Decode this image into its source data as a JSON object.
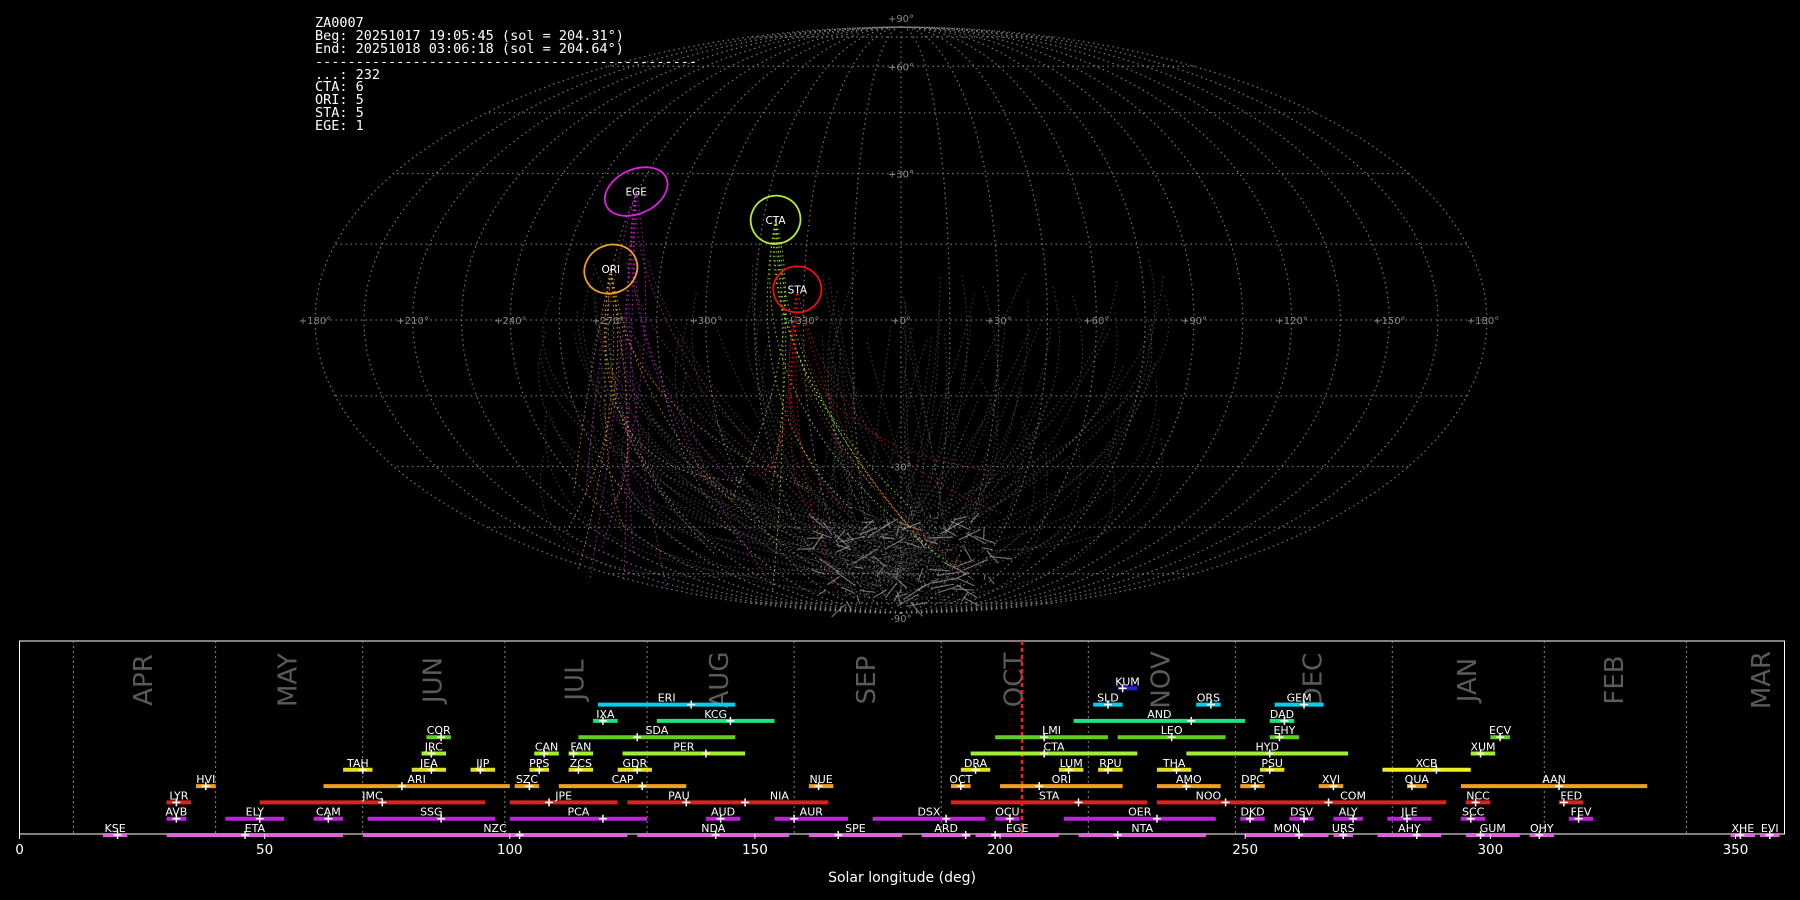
{
  "info": {
    "lines": [
      "ZA0007",
      "Beg: 20251017 19:05:45 (sol = 204.31°)",
      "End: 20251018 03:06:18 (sol = 204.64°)",
      "-----------------------------------------------",
      "...: 232",
      "CTA: 6",
      "ORI: 5",
      "STA: 5",
      "EGE: 1"
    ]
  },
  "sky_map": {
    "lon_labels": [
      "+180°",
      "+150°",
      "+120°",
      "+90°",
      "+60°",
      "+30°",
      "+0°",
      "+330°",
      "+300°",
      "+270°",
      "+240°",
      "+210°",
      "+180°"
    ],
    "lat_labels": [
      "+90°",
      "+60°",
      "+30°",
      "-30°",
      "-90°"
    ],
    "radiants": [
      {
        "code": "EGE",
        "color": "#e020e0",
        "lon": 90.5,
        "lat": 26,
        "rx": 33,
        "ry": 22,
        "rot": -25
      },
      {
        "code": "ORI",
        "color": "#f0a020",
        "lon": 90.5,
        "lat": 10,
        "rx": 27,
        "ry": 24,
        "rot": -25
      },
      {
        "code": "CTA",
        "color": "#b0f030",
        "lon": 41,
        "lat": 20,
        "rx": 25,
        "ry": 24,
        "rot": -20
      },
      {
        "code": "STA",
        "color": "#f01010",
        "lon": 32,
        "lat": 6,
        "rx": 24,
        "ry": 23,
        "rot": 0
      }
    ]
  },
  "chart_data": {
    "type": "timeline",
    "xlabel": "Solar longitude (deg)",
    "xlim": [
      0,
      360
    ],
    "xticks": [
      0,
      50,
      100,
      150,
      200,
      250,
      300,
      350
    ],
    "current_sol": 204.5,
    "months": [
      {
        "label": "APR",
        "sol": 11
      },
      {
        "label": "MAY",
        "sol": 40
      },
      {
        "label": "JUN",
        "sol": 70
      },
      {
        "label": "JUL",
        "sol": 99
      },
      {
        "label": "AUG",
        "sol": 128
      },
      {
        "label": "SEP",
        "sol": 158
      },
      {
        "label": "OCT",
        "sol": 188
      },
      {
        "label": "NOV",
        "sol": 218
      },
      {
        "label": "DEC",
        "sol": 248
      },
      {
        "label": "JAN",
        "sol": 280
      },
      {
        "label": "FEB",
        "sol": 311
      },
      {
        "label": "MAR",
        "sol": 340
      }
    ],
    "showers": [
      {
        "code": "KUM",
        "start": 224,
        "end": 228,
        "peak": 225,
        "row": 9,
        "color": "#2020e0"
      },
      {
        "code": "ERI",
        "start": 118,
        "end": 146,
        "peak": 137,
        "row": 8,
        "color": "#00d0f0"
      },
      {
        "code": "SLD",
        "start": 219,
        "end": 225,
        "peak": 222,
        "row": 8,
        "color": "#00d0f0"
      },
      {
        "code": "ORS",
        "start": 240,
        "end": 245,
        "peak": 243,
        "row": 8,
        "color": "#00d0f0"
      },
      {
        "code": "GEM",
        "start": 256,
        "end": 266,
        "peak": 262,
        "row": 8,
        "color": "#00d0f0"
      },
      {
        "code": "IXA",
        "start": 117,
        "end": 122,
        "peak": 119,
        "row": 7,
        "color": "#20e080"
      },
      {
        "code": "KCG",
        "start": 130,
        "end": 154,
        "peak": 145,
        "row": 7,
        "color": "#20e080"
      },
      {
        "code": "AND",
        "start": 215,
        "end": 250,
        "peak": 239,
        "row": 7,
        "color": "#20e080"
      },
      {
        "code": "DAD",
        "start": 255,
        "end": 260,
        "peak": 258,
        "row": 7,
        "color": "#20e080"
      },
      {
        "code": "COR",
        "start": 83,
        "end": 88,
        "peak": 86,
        "row": 6,
        "color": "#60d020"
      },
      {
        "code": "SDA",
        "start": 114,
        "end": 146,
        "peak": 126,
        "row": 6,
        "color": "#60d020"
      },
      {
        "code": "LMI",
        "start": 199,
        "end": 222,
        "peak": 209,
        "row": 6,
        "color": "#60d020"
      },
      {
        "code": "LEO",
        "start": 224,
        "end": 246,
        "peak": 235,
        "row": 6,
        "color": "#60d020"
      },
      {
        "code": "EHY",
        "start": 255,
        "end": 261,
        "peak": 257,
        "row": 6,
        "color": "#60d020"
      },
      {
        "code": "ECV",
        "start": 300,
        "end": 304,
        "peak": 302,
        "row": 6,
        "color": "#60d020"
      },
      {
        "code": "JRC",
        "start": 82,
        "end": 87,
        "peak": 84,
        "row": 5,
        "color": "#a0f030"
      },
      {
        "code": "CAN",
        "start": 105,
        "end": 110,
        "peak": 107,
        "row": 5,
        "color": "#a0f030"
      },
      {
        "code": "FAN",
        "start": 112,
        "end": 117,
        "peak": 113,
        "row": 5,
        "color": "#a0f030"
      },
      {
        "code": "PER",
        "start": 123,
        "end": 148,
        "peak": 140,
        "row": 5,
        "color": "#a0f030"
      },
      {
        "code": "CTA",
        "start": 194,
        "end": 228,
        "peak": 209,
        "row": 5,
        "color": "#a0f030"
      },
      {
        "code": "HYD",
        "start": 238,
        "end": 271,
        "peak": 255,
        "row": 5,
        "color": "#a0f030"
      },
      {
        "code": "XUM",
        "start": 296,
        "end": 301,
        "peak": 298,
        "row": 5,
        "color": "#a0f030"
      },
      {
        "code": "TAH",
        "start": 66,
        "end": 72,
        "peak": 70,
        "row": 4,
        "color": "#e0e020"
      },
      {
        "code": "JEA",
        "start": 80,
        "end": 87,
        "peak": 84,
        "row": 4,
        "color": "#e0e020"
      },
      {
        "code": "JIP",
        "start": 92,
        "end": 97,
        "peak": 94,
        "row": 4,
        "color": "#e0e020"
      },
      {
        "code": "PPS",
        "start": 104,
        "end": 108,
        "peak": 106,
        "row": 4,
        "color": "#e0e020"
      },
      {
        "code": "ZCS",
        "start": 112,
        "end": 117,
        "peak": 114,
        "row": 4,
        "color": "#e0e020"
      },
      {
        "code": "GDR",
        "start": 122,
        "end": 129,
        "peak": 126,
        "row": 4,
        "color": "#e0e020"
      },
      {
        "code": "DRA",
        "start": 192,
        "end": 198,
        "peak": 195,
        "row": 4,
        "color": "#e0e020"
      },
      {
        "code": "LUM",
        "start": 212,
        "end": 217,
        "peak": 214,
        "row": 4,
        "color": "#e0e020"
      },
      {
        "code": "RPU",
        "start": 220,
        "end": 225,
        "peak": 222,
        "row": 4,
        "color": "#e0e020"
      },
      {
        "code": "THA",
        "start": 232,
        "end": 239,
        "peak": 236,
        "row": 4,
        "color": "#e0e020"
      },
      {
        "code": "PSU",
        "start": 253,
        "end": 258,
        "peak": 255,
        "row": 4,
        "color": "#e0e020"
      },
      {
        "code": "XCB",
        "start": 278,
        "end": 296,
        "peak": 289,
        "row": 4,
        "color": "#f0f020"
      },
      {
        "code": "HVI",
        "start": 36,
        "end": 40,
        "peak": 38,
        "row": 3,
        "color": "#f0a020"
      },
      {
        "code": "ARI",
        "start": 62,
        "end": 100,
        "peak": 78,
        "row": 3,
        "color": "#f0a020"
      },
      {
        "code": "SZC",
        "start": 101,
        "end": 106,
        "peak": 104,
        "row": 3,
        "color": "#f0a020"
      },
      {
        "code": "CAP",
        "start": 110,
        "end": 136,
        "peak": 127,
        "row": 3,
        "color": "#f0a020"
      },
      {
        "code": "NUE",
        "start": 161,
        "end": 166,
        "peak": 163,
        "row": 3,
        "color": "#f0a020"
      },
      {
        "code": "OCT",
        "start": 190,
        "end": 194,
        "peak": 192,
        "row": 3,
        "color": "#f0a020"
      },
      {
        "code": "ORI",
        "start": 200,
        "end": 225,
        "peak": 208,
        "row": 3,
        "color": "#f0a020"
      },
      {
        "code": "AMO",
        "start": 232,
        "end": 245,
        "peak": 238,
        "row": 3,
        "color": "#f0a020"
      },
      {
        "code": "DPC",
        "start": 249,
        "end": 254,
        "peak": 252,
        "row": 3,
        "color": "#f0a020"
      },
      {
        "code": "XVI",
        "start": 265,
        "end": 270,
        "peak": 268,
        "row": 3,
        "color": "#f0a020"
      },
      {
        "code": "QUA",
        "start": 283,
        "end": 287,
        "peak": 284,
        "row": 3,
        "color": "#f0a020"
      },
      {
        "code": "AAN",
        "start": 294,
        "end": 332,
        "peak": 314,
        "row": 3,
        "color": "#f0a020"
      },
      {
        "code": "LYR",
        "start": 30,
        "end": 35,
        "peak": 32,
        "row": 2,
        "color": "#e02020"
      },
      {
        "code": "JMC",
        "start": 49,
        "end": 95,
        "peak": 74,
        "row": 2,
        "color": "#e02020"
      },
      {
        "code": "JPE",
        "start": 100,
        "end": 122,
        "peak": 108,
        "row": 2,
        "color": "#e02020"
      },
      {
        "code": "PAU",
        "start": 124,
        "end": 145,
        "peak": 136,
        "row": 2,
        "color": "#e02020"
      },
      {
        "code": "NIA",
        "start": 145,
        "end": 165,
        "peak": 148,
        "row": 2,
        "color": "#e02020"
      },
      {
        "code": "STA",
        "start": 190,
        "end": 230,
        "peak": 216,
        "row": 2,
        "color": "#e02020"
      },
      {
        "code": "NOO",
        "start": 232,
        "end": 253,
        "peak": 246,
        "row": 2,
        "color": "#e02020"
      },
      {
        "code": "COM",
        "start": 253,
        "end": 291,
        "peak": 267,
        "row": 2,
        "color": "#e02020"
      },
      {
        "code": "NCC",
        "start": 295,
        "end": 300,
        "peak": 297,
        "row": 2,
        "color": "#e02020"
      },
      {
        "code": "FED",
        "start": 314,
        "end": 319,
        "peak": 315,
        "row": 2,
        "color": "#e02020"
      },
      {
        "code": "AVB",
        "start": 30,
        "end": 34,
        "peak": 32,
        "row": 1,
        "color": "#c020e0"
      },
      {
        "code": "ELY",
        "start": 42,
        "end": 54,
        "peak": 49,
        "row": 1,
        "color": "#c020e0"
      },
      {
        "code": "CAM",
        "start": 60,
        "end": 66,
        "peak": 63,
        "row": 1,
        "color": "#c020e0"
      },
      {
        "code": "SSG",
        "start": 71,
        "end": 97,
        "peak": 86,
        "row": 1,
        "color": "#c020e0"
      },
      {
        "code": "PCA",
        "start": 100,
        "end": 128,
        "peak": 119,
        "row": 1,
        "color": "#c020e0"
      },
      {
        "code": "AUD",
        "start": 140,
        "end": 147,
        "peak": 143,
        "row": 1,
        "color": "#c020e0"
      },
      {
        "code": "AUR",
        "start": 154,
        "end": 169,
        "peak": 158,
        "row": 1,
        "color": "#c020e0"
      },
      {
        "code": "DSX",
        "start": 174,
        "end": 197,
        "peak": 189,
        "row": 1,
        "color": "#c020e0"
      },
      {
        "code": "OCU",
        "start": 199,
        "end": 204,
        "peak": 202,
        "row": 1,
        "color": "#c020e0"
      },
      {
        "code": "OER",
        "start": 213,
        "end": 244,
        "peak": 232,
        "row": 1,
        "color": "#c020e0"
      },
      {
        "code": "DKD",
        "start": 249,
        "end": 254,
        "peak": 251,
        "row": 1,
        "color": "#c020e0"
      },
      {
        "code": "DSV",
        "start": 259,
        "end": 264,
        "peak": 262,
        "row": 1,
        "color": "#c020e0"
      },
      {
        "code": "ALY",
        "start": 268,
        "end": 274,
        "peak": 272,
        "row": 1,
        "color": "#c020e0"
      },
      {
        "code": "JLE",
        "start": 279,
        "end": 288,
        "peak": 283,
        "row": 1,
        "color": "#c020e0"
      },
      {
        "code": "SCC",
        "start": 294,
        "end": 299,
        "peak": 296,
        "row": 1,
        "color": "#c020e0"
      },
      {
        "code": "FEV",
        "start": 316,
        "end": 321,
        "peak": 318,
        "row": 1,
        "color": "#c020e0"
      },
      {
        "code": "KSE",
        "start": 17,
        "end": 22,
        "peak": 20,
        "row": 0,
        "color": "#e060e0"
      },
      {
        "code": "ETA",
        "start": 30,
        "end": 66,
        "peak": 46,
        "row": 0,
        "color": "#e060e0"
      },
      {
        "code": "NZC",
        "start": 70,
        "end": 124,
        "peak": 102,
        "row": 0,
        "color": "#e060e0"
      },
      {
        "code": "NDA",
        "start": 126,
        "end": 157,
        "peak": 142,
        "row": 0,
        "color": "#e060e0"
      },
      {
        "code": "SPE",
        "start": 161,
        "end": 180,
        "peak": 167,
        "row": 0,
        "color": "#e060e0"
      },
      {
        "code": "ARD",
        "start": 184,
        "end": 194,
        "peak": 193,
        "row": 0,
        "color": "#e060e0"
      },
      {
        "code": "EGE",
        "start": 195,
        "end": 212,
        "peak": 199,
        "row": 0,
        "color": "#e060e0"
      },
      {
        "code": "NTA",
        "start": 216,
        "end": 242,
        "peak": 224,
        "row": 0,
        "color": "#e060e0"
      },
      {
        "code": "MON",
        "start": 250,
        "end": 267,
        "peak": 261,
        "row": 0,
        "color": "#e060e0"
      },
      {
        "code": "URS",
        "start": 268,
        "end": 272,
        "peak": 270,
        "row": 0,
        "color": "#e060e0"
      },
      {
        "code": "AHY",
        "start": 277,
        "end": 290,
        "peak": 285,
        "row": 0,
        "color": "#e060e0"
      },
      {
        "code": "GUM",
        "start": 295,
        "end": 306,
        "peak": 298,
        "row": 0,
        "color": "#e060e0"
      },
      {
        "code": "OHY",
        "start": 308,
        "end": 313,
        "peak": 310,
        "row": 0,
        "color": "#e060e0"
      },
      {
        "code": "XHE",
        "start": 349,
        "end": 354,
        "peak": 351,
        "row": 0,
        "color": "#e060e0"
      },
      {
        "code": "EVI",
        "start": 355,
        "end": 359,
        "peak": 357,
        "row": 0,
        "color": "#e060e0"
      }
    ]
  }
}
